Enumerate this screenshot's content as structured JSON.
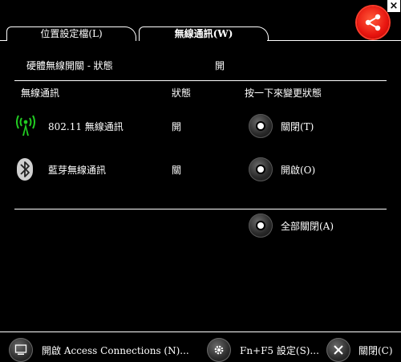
{
  "window": {
    "close_glyph": "×"
  },
  "tabs": [
    {
      "label": "位置設定檔(L)"
    },
    {
      "label": "無線通訊(W)"
    }
  ],
  "hardware_switch": {
    "label": "硬體無線開關 - 狀態",
    "value": "開"
  },
  "table": {
    "headers": {
      "name": "無線通訊",
      "status": "狀態",
      "action": "按一下來變更狀態"
    },
    "rows": [
      {
        "icon": "wifi-antenna-icon",
        "name": "802.11 無線通訊",
        "status": "開",
        "action": "關閉(T)"
      },
      {
        "icon": "bluetooth-icon",
        "name": "藍芽無線通訊",
        "status": "關",
        "action": "開啟(O)"
      }
    ],
    "all_off": "全部關閉(A)"
  },
  "footer": {
    "open_ac": "開啟 Access Connections (N)...",
    "fn_f5": "Fn+F5 設定(S)...",
    "close": "關閉(C)"
  },
  "colors": {
    "background": "#000000",
    "wifi_green": "#22cc22",
    "share_red": "#e8150f"
  }
}
